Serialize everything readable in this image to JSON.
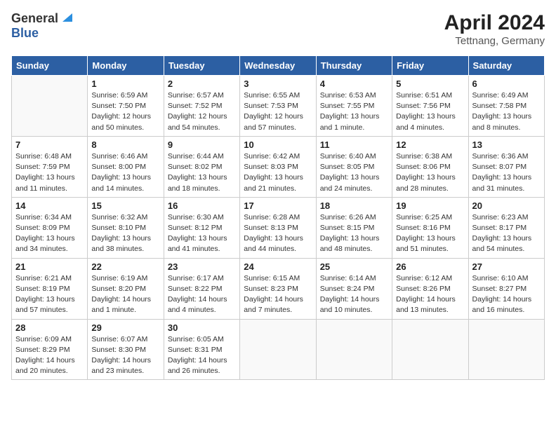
{
  "header": {
    "logo_general": "General",
    "logo_blue": "Blue",
    "month_year": "April 2024",
    "location": "Tettnang, Germany"
  },
  "days_of_week": [
    "Sunday",
    "Monday",
    "Tuesday",
    "Wednesday",
    "Thursday",
    "Friday",
    "Saturday"
  ],
  "weeks": [
    [
      {
        "day": "",
        "info": ""
      },
      {
        "day": "1",
        "info": "Sunrise: 6:59 AM\nSunset: 7:50 PM\nDaylight: 12 hours\nand 50 minutes."
      },
      {
        "day": "2",
        "info": "Sunrise: 6:57 AM\nSunset: 7:52 PM\nDaylight: 12 hours\nand 54 minutes."
      },
      {
        "day": "3",
        "info": "Sunrise: 6:55 AM\nSunset: 7:53 PM\nDaylight: 12 hours\nand 57 minutes."
      },
      {
        "day": "4",
        "info": "Sunrise: 6:53 AM\nSunset: 7:55 PM\nDaylight: 13 hours\nand 1 minute."
      },
      {
        "day": "5",
        "info": "Sunrise: 6:51 AM\nSunset: 7:56 PM\nDaylight: 13 hours\nand 4 minutes."
      },
      {
        "day": "6",
        "info": "Sunrise: 6:49 AM\nSunset: 7:58 PM\nDaylight: 13 hours\nand 8 minutes."
      }
    ],
    [
      {
        "day": "7",
        "info": "Sunrise: 6:48 AM\nSunset: 7:59 PM\nDaylight: 13 hours\nand 11 minutes."
      },
      {
        "day": "8",
        "info": "Sunrise: 6:46 AM\nSunset: 8:00 PM\nDaylight: 13 hours\nand 14 minutes."
      },
      {
        "day": "9",
        "info": "Sunrise: 6:44 AM\nSunset: 8:02 PM\nDaylight: 13 hours\nand 18 minutes."
      },
      {
        "day": "10",
        "info": "Sunrise: 6:42 AM\nSunset: 8:03 PM\nDaylight: 13 hours\nand 21 minutes."
      },
      {
        "day": "11",
        "info": "Sunrise: 6:40 AM\nSunset: 8:05 PM\nDaylight: 13 hours\nand 24 minutes."
      },
      {
        "day": "12",
        "info": "Sunrise: 6:38 AM\nSunset: 8:06 PM\nDaylight: 13 hours\nand 28 minutes."
      },
      {
        "day": "13",
        "info": "Sunrise: 6:36 AM\nSunset: 8:07 PM\nDaylight: 13 hours\nand 31 minutes."
      }
    ],
    [
      {
        "day": "14",
        "info": "Sunrise: 6:34 AM\nSunset: 8:09 PM\nDaylight: 13 hours\nand 34 minutes."
      },
      {
        "day": "15",
        "info": "Sunrise: 6:32 AM\nSunset: 8:10 PM\nDaylight: 13 hours\nand 38 minutes."
      },
      {
        "day": "16",
        "info": "Sunrise: 6:30 AM\nSunset: 8:12 PM\nDaylight: 13 hours\nand 41 minutes."
      },
      {
        "day": "17",
        "info": "Sunrise: 6:28 AM\nSunset: 8:13 PM\nDaylight: 13 hours\nand 44 minutes."
      },
      {
        "day": "18",
        "info": "Sunrise: 6:26 AM\nSunset: 8:15 PM\nDaylight: 13 hours\nand 48 minutes."
      },
      {
        "day": "19",
        "info": "Sunrise: 6:25 AM\nSunset: 8:16 PM\nDaylight: 13 hours\nand 51 minutes."
      },
      {
        "day": "20",
        "info": "Sunrise: 6:23 AM\nSunset: 8:17 PM\nDaylight: 13 hours\nand 54 minutes."
      }
    ],
    [
      {
        "day": "21",
        "info": "Sunrise: 6:21 AM\nSunset: 8:19 PM\nDaylight: 13 hours\nand 57 minutes."
      },
      {
        "day": "22",
        "info": "Sunrise: 6:19 AM\nSunset: 8:20 PM\nDaylight: 14 hours\nand 1 minute."
      },
      {
        "day": "23",
        "info": "Sunrise: 6:17 AM\nSunset: 8:22 PM\nDaylight: 14 hours\nand 4 minutes."
      },
      {
        "day": "24",
        "info": "Sunrise: 6:15 AM\nSunset: 8:23 PM\nDaylight: 14 hours\nand 7 minutes."
      },
      {
        "day": "25",
        "info": "Sunrise: 6:14 AM\nSunset: 8:24 PM\nDaylight: 14 hours\nand 10 minutes."
      },
      {
        "day": "26",
        "info": "Sunrise: 6:12 AM\nSunset: 8:26 PM\nDaylight: 14 hours\nand 13 minutes."
      },
      {
        "day": "27",
        "info": "Sunrise: 6:10 AM\nSunset: 8:27 PM\nDaylight: 14 hours\nand 16 minutes."
      }
    ],
    [
      {
        "day": "28",
        "info": "Sunrise: 6:09 AM\nSunset: 8:29 PM\nDaylight: 14 hours\nand 20 minutes."
      },
      {
        "day": "29",
        "info": "Sunrise: 6:07 AM\nSunset: 8:30 PM\nDaylight: 14 hours\nand 23 minutes."
      },
      {
        "day": "30",
        "info": "Sunrise: 6:05 AM\nSunset: 8:31 PM\nDaylight: 14 hours\nand 26 minutes."
      },
      {
        "day": "",
        "info": ""
      },
      {
        "day": "",
        "info": ""
      },
      {
        "day": "",
        "info": ""
      },
      {
        "day": "",
        "info": ""
      }
    ]
  ]
}
